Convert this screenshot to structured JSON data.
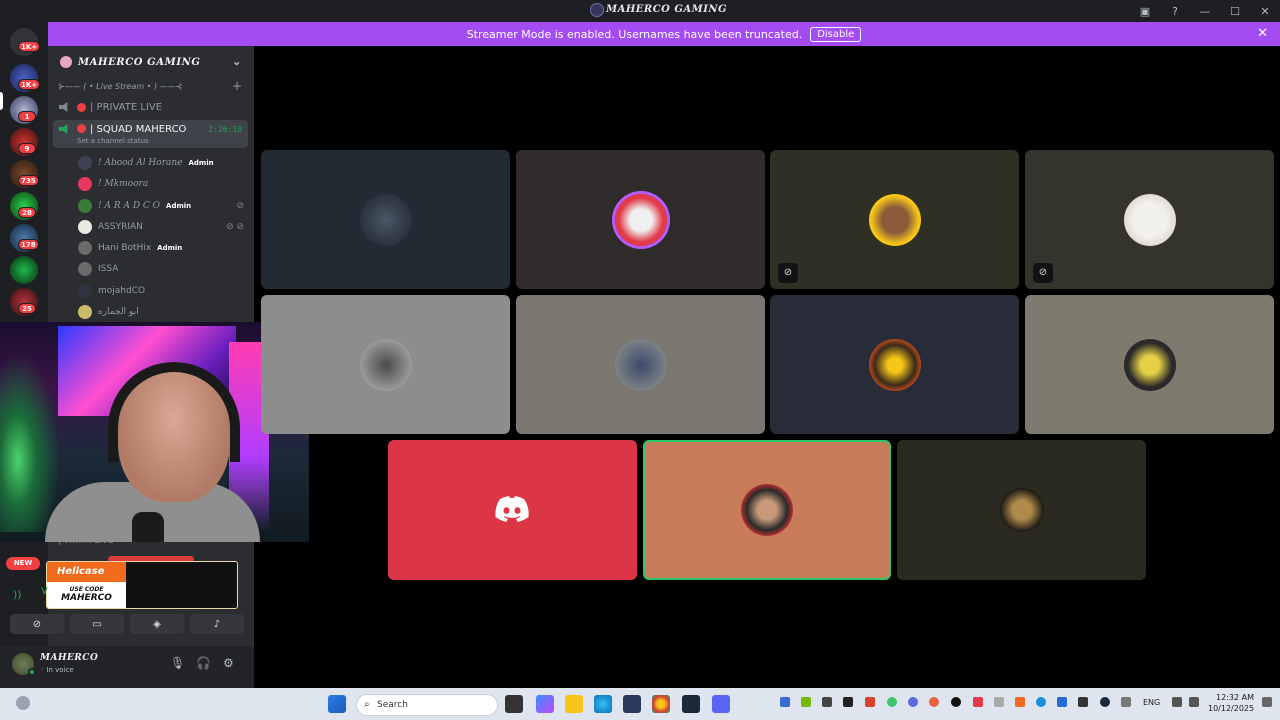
{
  "window": {
    "title": "MAHERCO GAMING"
  },
  "banner": {
    "text": "Streamer Mode is enabled. Usernames have been truncated.",
    "button": "Disable"
  },
  "guild_badges": [
    "1K+",
    "1K+",
    "1",
    "9",
    "735",
    "28",
    "178",
    "25"
  ],
  "server": {
    "name": "MAHERCO GAMING",
    "category": "⊱—— ( • Live Stream • ) ——⊰",
    "channels": [
      {
        "name": "| PRIVATE LIVE"
      },
      {
        "name": "| SQUAD MAHERCO",
        "timer": "2:26:10",
        "status": "Set a channel status"
      }
    ],
    "members": [
      {
        "name": "! Abood Al Horane",
        "admin": "Admin"
      },
      {
        "name": "! Mkmoora"
      },
      {
        "name": "! A R A D C O",
        "admin": "Admin"
      },
      {
        "name": "ASSYRIAN"
      },
      {
        "name": "Hani BotHix",
        "admin": "Admin"
      },
      {
        "name": "ISSA"
      },
      {
        "name": "mojahdCO"
      },
      {
        "name": "ابو الجماره"
      }
    ],
    "lower_channel": "| TIKTIK LIVE"
  },
  "promo": {
    "brand": "Hellcase",
    "code_label": "USE CODE",
    "code": "MAHERCO",
    "new_badge": "NEW"
  },
  "voice_bar": {
    "label": "V"
  },
  "user": {
    "name": "MAHERCO",
    "status": "In voice"
  },
  "colors": {
    "accent": "#a24cf1",
    "online": "#23a55a",
    "danger": "#f23f42",
    "sidebar": "#2b2d31"
  },
  "taskbar": {
    "search_placeholder": "Search",
    "lang": "ENG",
    "time": "12:32 AM",
    "date": "10/12/2025"
  }
}
